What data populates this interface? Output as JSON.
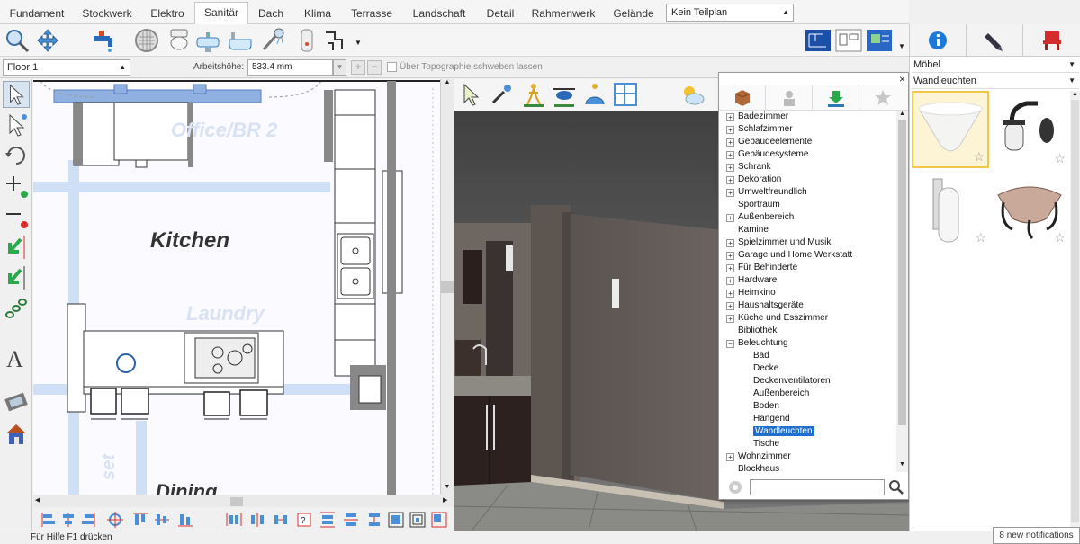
{
  "tabs": [
    "Fundament",
    "Stockwerk",
    "Elektro",
    "Sanitär",
    "Dach",
    "Klima",
    "Terrasse",
    "Landschaft",
    "Detail",
    "Rahmenwerk",
    "Gelände"
  ],
  "active_tab": "Sanitär",
  "plan_select": {
    "value": "Kein Teilplan"
  },
  "options": {
    "floor": "Floor 1",
    "height_label": "Arbeitshöhe:",
    "height_value": "533.4 mm",
    "topo_label": "Über Topographie schweben lassen"
  },
  "plan": {
    "rooms": [
      "Office/BR 2",
      "Kitchen",
      "Laundry",
      "Dining",
      "set"
    ]
  },
  "library": {
    "close": "×",
    "tree": [
      {
        "label": "Badezimmer",
        "exp": "+",
        "level": 0
      },
      {
        "label": "Schlafzimmer",
        "exp": "+",
        "level": 0
      },
      {
        "label": "Gebäudeelemente",
        "exp": "+",
        "level": 0
      },
      {
        "label": "Gebäudesysteme",
        "exp": "+",
        "level": 0
      },
      {
        "label": "Schrank",
        "exp": "+",
        "level": 0
      },
      {
        "label": "Dekoration",
        "exp": "+",
        "level": 0
      },
      {
        "label": "Umweltfreundlich",
        "exp": "+",
        "level": 0
      },
      {
        "label": "Sportraum",
        "exp": "",
        "level": 0
      },
      {
        "label": "Außenbereich",
        "exp": "+",
        "level": 0
      },
      {
        "label": "Kamine",
        "exp": "",
        "level": 0
      },
      {
        "label": "Spielzimmer und Musik",
        "exp": "+",
        "level": 0
      },
      {
        "label": "Garage und Home Werkstatt",
        "exp": "+",
        "level": 0
      },
      {
        "label": "Für Behinderte",
        "exp": "+",
        "level": 0
      },
      {
        "label": "Hardware",
        "exp": "+",
        "level": 0
      },
      {
        "label": "Heimkino",
        "exp": "+",
        "level": 0
      },
      {
        "label": "Haushaltsgeräte",
        "exp": "+",
        "level": 0
      },
      {
        "label": "Küche und Esszimmer",
        "exp": "+",
        "level": 0
      },
      {
        "label": "Bibliothek",
        "exp": "",
        "level": 0
      },
      {
        "label": "Beleuchtung",
        "exp": "−",
        "level": 0
      },
      {
        "label": "Bad",
        "exp": "",
        "level": 1
      },
      {
        "label": "Decke",
        "exp": "",
        "level": 1
      },
      {
        "label": "Deckenventilatoren",
        "exp": "",
        "level": 1
      },
      {
        "label": "Außenbereich",
        "exp": "",
        "level": 1
      },
      {
        "label": "Boden",
        "exp": "",
        "level": 1
      },
      {
        "label": "Hängend",
        "exp": "",
        "level": 1
      },
      {
        "label": "Wandleuchten",
        "exp": "",
        "level": 1,
        "selected": true
      },
      {
        "label": "Tische",
        "exp": "",
        "level": 1
      },
      {
        "label": "Wohnzimmer",
        "exp": "+",
        "level": 0
      },
      {
        "label": "Blockhaus",
        "exp": "",
        "level": 0
      }
    ]
  },
  "right_panel": {
    "category": "Möbel",
    "subcategory": "Wandleuchten"
  },
  "status": "Für Hilfe F1 drücken",
  "notifications": "8 new notifications",
  "colors": {
    "accent": "#1e6fd0",
    "wall": "#333333",
    "highlight": "#f2c84b"
  }
}
